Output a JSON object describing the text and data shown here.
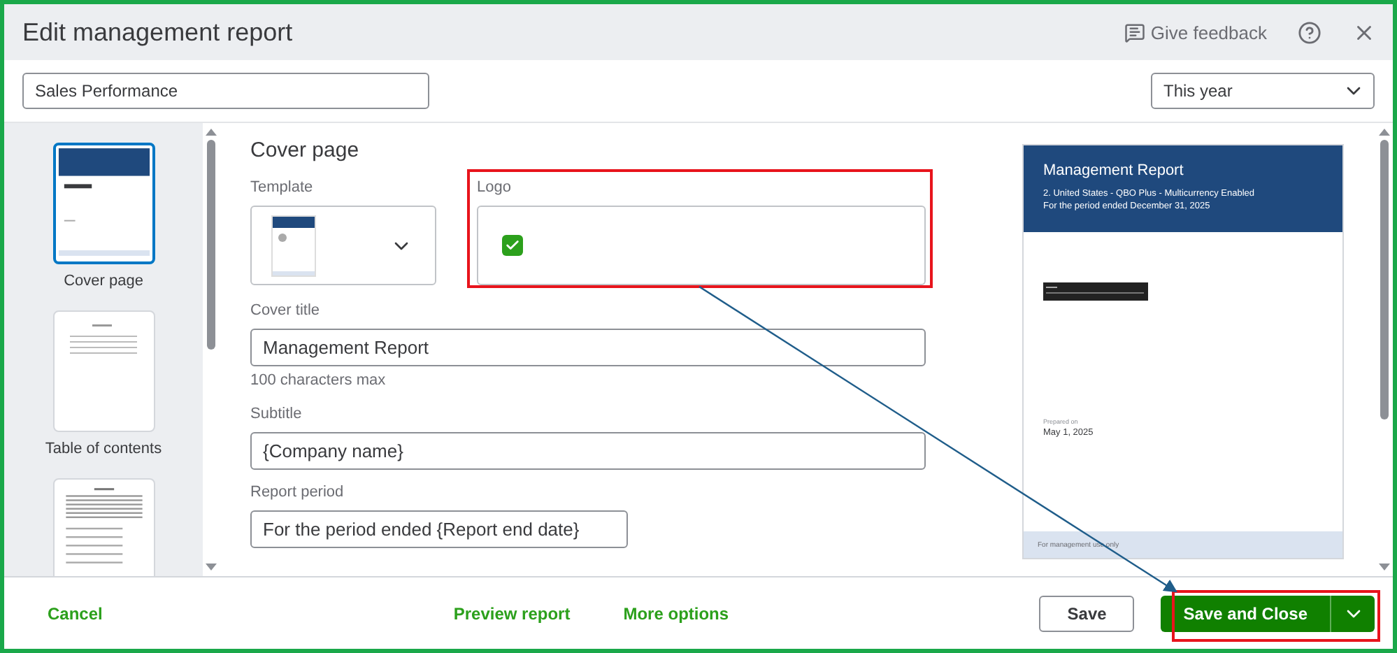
{
  "window": {
    "title": "Edit management report",
    "actions": [
      {
        "kind": "feedback",
        "label": "Give feedback"
      },
      {
        "kind": "help"
      },
      {
        "kind": "close"
      }
    ]
  },
  "report_name": {
    "value": "Sales Performance"
  },
  "period_select": {
    "value": "This year"
  },
  "sections": [
    {
      "kind": "cover",
      "label": "Cover page",
      "selected": true
    },
    {
      "kind": "toc",
      "label": "Table of contents",
      "selected": false
    },
    {
      "kind": "text",
      "selected": false
    }
  ],
  "editor": {
    "heading": "Cover page",
    "template": {
      "label": "Template"
    },
    "logo": {
      "label": "Logo",
      "checked": true,
      "highlighted": true
    },
    "cover_title": {
      "label": "Cover title",
      "value": "Management Report",
      "hint": "100 characters max"
    },
    "subtitle": {
      "label": "Subtitle",
      "value": "{Company name}"
    },
    "report_period": {
      "label": "Report period",
      "value": "For the period ended {Report end date}"
    }
  },
  "preview": {
    "title": "Management Report",
    "lines": [
      "2. United States - QBO Plus - Multicurrency Enabled",
      "For the period ended December 31, 2025"
    ],
    "prepared_label": "Prepared on",
    "prepared_date": "May 1, 2025",
    "footer": "For management use only"
  },
  "footer": {
    "cancel": "Cancel",
    "links": [
      "Preview report",
      "More options"
    ],
    "save": "Save",
    "save_close": {
      "label": "Save and Close",
      "highlighted": true
    }
  },
  "callout_arrow": true
}
